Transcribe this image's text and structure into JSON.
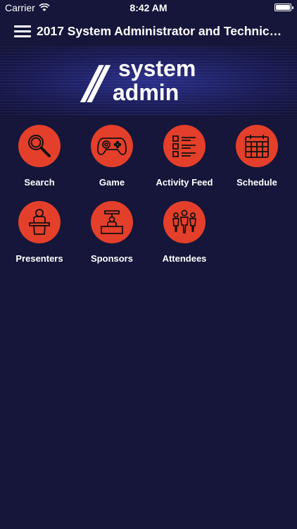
{
  "status_bar": {
    "carrier": "Carrier",
    "time": "8:42 AM"
  },
  "nav": {
    "title": "2017 System Administrator and Technical..."
  },
  "banner": {
    "logo_slashes": "//",
    "logo_line1": "system",
    "logo_line2": "admin"
  },
  "tiles": [
    {
      "label": "Search"
    },
    {
      "label": "Game"
    },
    {
      "label": "Activity Feed"
    },
    {
      "label": "Schedule"
    },
    {
      "label": "Presenters"
    },
    {
      "label": "Sponsors"
    },
    {
      "label": "Attendees"
    }
  ],
  "colors": {
    "background": "#15163a",
    "accent": "#e43f2a",
    "text": "#ffffff"
  }
}
